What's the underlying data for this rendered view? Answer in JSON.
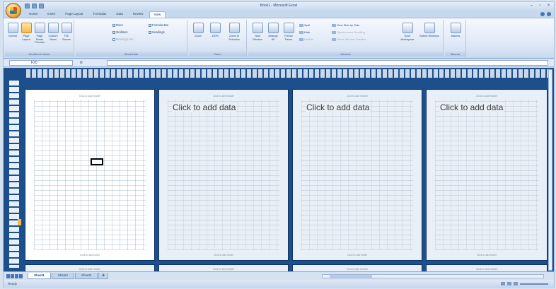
{
  "app": {
    "title": "Book1 - Microsoft Excel"
  },
  "tabs": [
    {
      "label": "Home"
    },
    {
      "label": "Insert"
    },
    {
      "label": "Page Layout"
    },
    {
      "label": "Formulas"
    },
    {
      "label": "Data"
    },
    {
      "label": "Review"
    },
    {
      "label": "View",
      "active": true
    }
  ],
  "ribbon": {
    "workbook_views": {
      "label": "Workbook Views",
      "buttons": [
        "Normal",
        "Page Layout",
        "Page Break Preview",
        "Custom Views",
        "Full Screen"
      ]
    },
    "show_hide": {
      "label": "Show/Hide",
      "checks": [
        "Ruler",
        "Gridlines",
        "Message Bar",
        "Formula Bar",
        "Headings"
      ]
    },
    "zoom": {
      "label": "Zoom",
      "buttons": [
        "Zoom",
        "100%",
        "Zoom to Selection"
      ]
    },
    "window": {
      "label": "Window",
      "buttons": [
        "New Window",
        "Arrange All",
        "Freeze Panes"
      ],
      "small": [
        "Split",
        "Hide",
        "Unhide",
        "View Side by Side",
        "Synchronous Scrolling",
        "Reset Window Position"
      ],
      "buttons2": [
        "Save Workspace",
        "Switch Windows"
      ]
    },
    "macros": {
      "label": "Macros",
      "buttons": [
        "Macros"
      ]
    }
  },
  "formula_bar": {
    "name_box": "F20",
    "fx": "fx",
    "value": ""
  },
  "pages": [
    {
      "header": "Click to add header",
      "footer": "Click to add footer",
      "placeholder": ""
    },
    {
      "header": "Click to add header",
      "footer": "Click to add footer",
      "placeholder": "Click to add data"
    },
    {
      "header": "Click to add header",
      "footer": "Click to add footer",
      "placeholder": "Click to add data"
    },
    {
      "header": "Click to add header",
      "footer": "Click to add footer",
      "placeholder": "Click to add data"
    }
  ],
  "pages_bottom": [
    "Click to add header",
    "Click to add header",
    "Click to add header",
    "Click to add header"
  ],
  "sheet_tabs": [
    {
      "label": "Sheet1",
      "active": true
    },
    {
      "label": "Sheet2"
    },
    {
      "label": "Sheet3"
    }
  ],
  "status": {
    "ready": "Ready"
  }
}
